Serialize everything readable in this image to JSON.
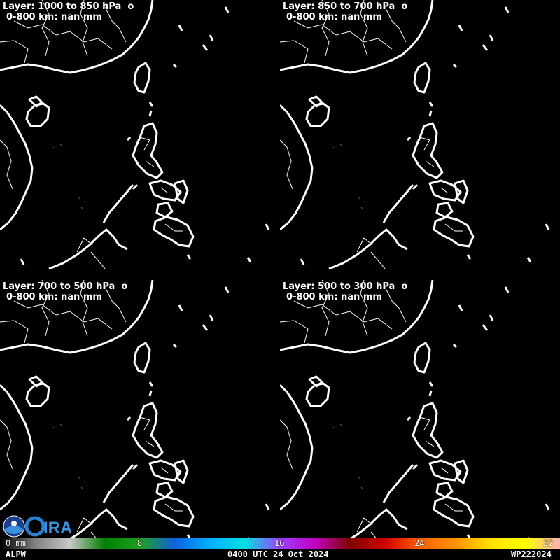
{
  "panels": [
    {
      "layer": "Layer: 1000 to 850 hPa  o",
      "stats": "0-800 km: nan mm"
    },
    {
      "layer": "Layer: 850 to 700 hPa  o",
      "stats": "0-800 km: nan mm"
    },
    {
      "layer": "Layer: 700 to 500 hPa  o",
      "stats": "0-800 km: nan mm"
    },
    {
      "layer": "Layer: 500 to 300 hPa  o",
      "stats": "0-800 km: nan mm"
    }
  ],
  "colorbar": {
    "ticks": [
      "0 mm",
      "8",
      "16",
      "24",
      "32"
    ],
    "colors": [
      "#000000",
      "#808080",
      "#c8c8c8",
      "#008000",
      "#20a020",
      "#1060e0",
      "#00b0ff",
      "#00e0e0",
      "#a040ff",
      "#c000c0",
      "#800000",
      "#d00000",
      "#ff6000",
      "#ff9000",
      "#ffe000",
      "#ffff00",
      "#ffb0b0"
    ]
  },
  "footer": {
    "product": "ALPW",
    "time": "0400 UTC 24 Oct 2024",
    "storm": "WP222024"
  },
  "logos": {
    "noaa": "NOAA",
    "cira": "CIRA"
  }
}
